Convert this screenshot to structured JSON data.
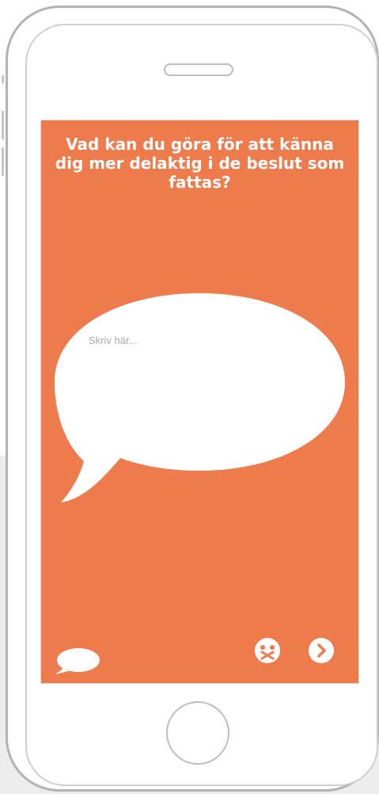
{
  "question": {
    "text": "Vad kan du göra för att känna dig mer delaktig i de beslut som fattas?"
  },
  "answer": {
    "placeholder": "Skriv här...",
    "value": ""
  },
  "toolbar": {
    "left_icon": "speech-bubble-icon",
    "middle_icon": "silent-face-icon",
    "right_icon": "chevron-right-icon"
  },
  "colors": {
    "screen_background": "#ee7b4c",
    "bubble": "#ffffff",
    "icon_glyph": "#ee7b4c"
  }
}
